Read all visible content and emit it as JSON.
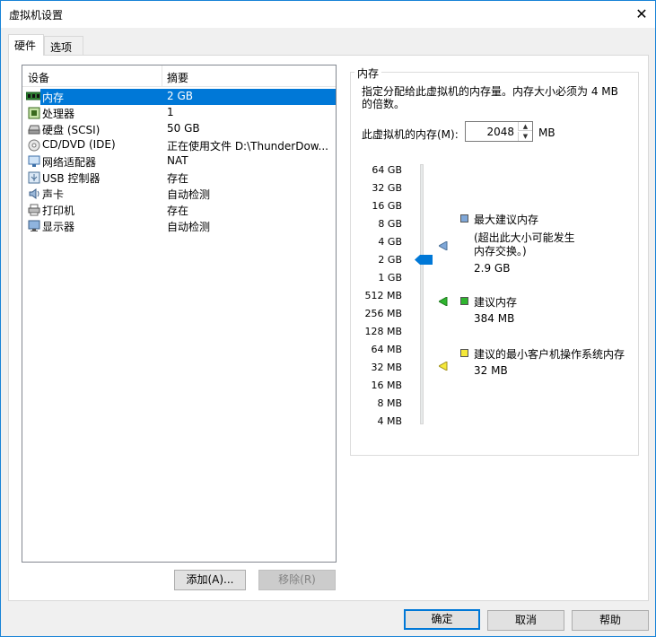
{
  "window": {
    "title": "虚拟机设置",
    "close_glyph": "✕"
  },
  "tabs": [
    {
      "label": "硬件"
    },
    {
      "label": "选项"
    }
  ],
  "device_list": {
    "columns": {
      "device": "设备",
      "summary": "摘要"
    },
    "rows": [
      {
        "name": "内存",
        "summary": "2 GB",
        "icon": "memory-icon"
      },
      {
        "name": "处理器",
        "summary": "1",
        "icon": "cpu-icon"
      },
      {
        "name": "硬盘 (SCSI)",
        "summary": "50 GB",
        "icon": "hard-disk-icon"
      },
      {
        "name": "CD/DVD (IDE)",
        "summary": "正在使用文件 D:\\ThunderDow...",
        "icon": "cd-dvd-icon"
      },
      {
        "name": "网络适配器",
        "summary": "NAT",
        "icon": "network-adapter-icon"
      },
      {
        "name": "USB 控制器",
        "summary": "存在",
        "icon": "usb-icon"
      },
      {
        "name": "声卡",
        "summary": "自动检测",
        "icon": "sound-card-icon"
      },
      {
        "name": "打印机",
        "summary": "存在",
        "icon": "printer-icon"
      },
      {
        "name": "显示器",
        "summary": "自动检测",
        "icon": "display-icon"
      }
    ],
    "selected_index": 0
  },
  "list_buttons": {
    "add": "添加(A)...",
    "remove": "移除(R)"
  },
  "memory": {
    "group_title": "内存",
    "description": "指定分配给此虚拟机的内存量。内存大小必须为 4 MB 的倍数。",
    "input_label": "此虚拟机的内存(M):",
    "value": "2048",
    "unit": "MB",
    "scale_labels": [
      "64 GB",
      "32 GB",
      "16 GB",
      "8 GB",
      "4 GB",
      "2 GB",
      "1 GB",
      "512 MB",
      "256 MB",
      "128 MB",
      "64 MB",
      "32 MB",
      "16 MB",
      "8 MB",
      "4 MB"
    ],
    "slider_level_label": "2 GB",
    "legend": [
      {
        "title": "最大建议内存",
        "note": "(超出此大小可能发生内存交换。)",
        "value": "2.9 GB",
        "color": "#7fa7d8"
      },
      {
        "title": "建议内存",
        "value": "384 MB",
        "color": "#2fb52f"
      },
      {
        "title": "建议的最小客户机操作系统内存",
        "value": "32 MB",
        "color": "#f5e83a"
      }
    ]
  },
  "footer_buttons": {
    "ok": "确定",
    "cancel": "取消",
    "help": "帮助"
  },
  "colors": {
    "selection": "#0078d7",
    "accent_border": "#0078d7"
  }
}
